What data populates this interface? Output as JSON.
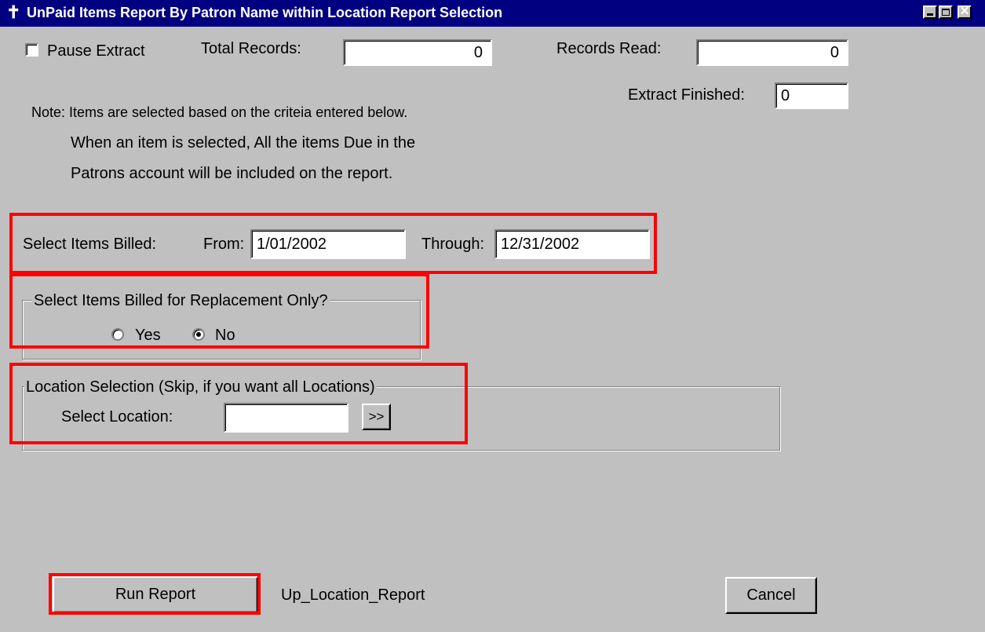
{
  "window": {
    "title": "UnPaid Items Report By Patron Name within Location Report Selection",
    "icon": "app-icon",
    "controls": [
      "minimize-icon",
      "maximize-icon",
      "close-icon"
    ]
  },
  "status": {
    "pause_label": "Pause Extract",
    "pause_checked": false,
    "total_records_label": "Total Records:",
    "total_records_value": "0",
    "records_read_label": "Records Read:",
    "records_read_value": "0",
    "extract_finished_label": "Extract Finished:",
    "extract_finished_value": "0"
  },
  "note": {
    "line1": "Note: Items are selected based on the criteia entered below.",
    "line2": "When an item is selected, All the items Due in the",
    "line3": "Patrons account will be included on the report."
  },
  "billed": {
    "label": "Select Items Billed:",
    "from_label": "From:",
    "from_value": "1/01/2002",
    "through_label": "Through:",
    "through_value": "12/31/2002"
  },
  "replacement": {
    "legend": "Select Items Billed for Replacement Only?",
    "yes_label": "Yes",
    "no_label": "No",
    "selected": "No"
  },
  "location": {
    "legend": "Location Selection (Skip, if you want all Locations)",
    "select_label": "Select Location:",
    "value": "",
    "browse_label": ">>"
  },
  "footer": {
    "run_label": "Run Report",
    "report_name": "Up_Location_Report",
    "cancel_label": "Cancel"
  },
  "colors": {
    "titlebar": "#000080",
    "window_bg": "#c0c0c0",
    "highlight": "#ff0000"
  }
}
